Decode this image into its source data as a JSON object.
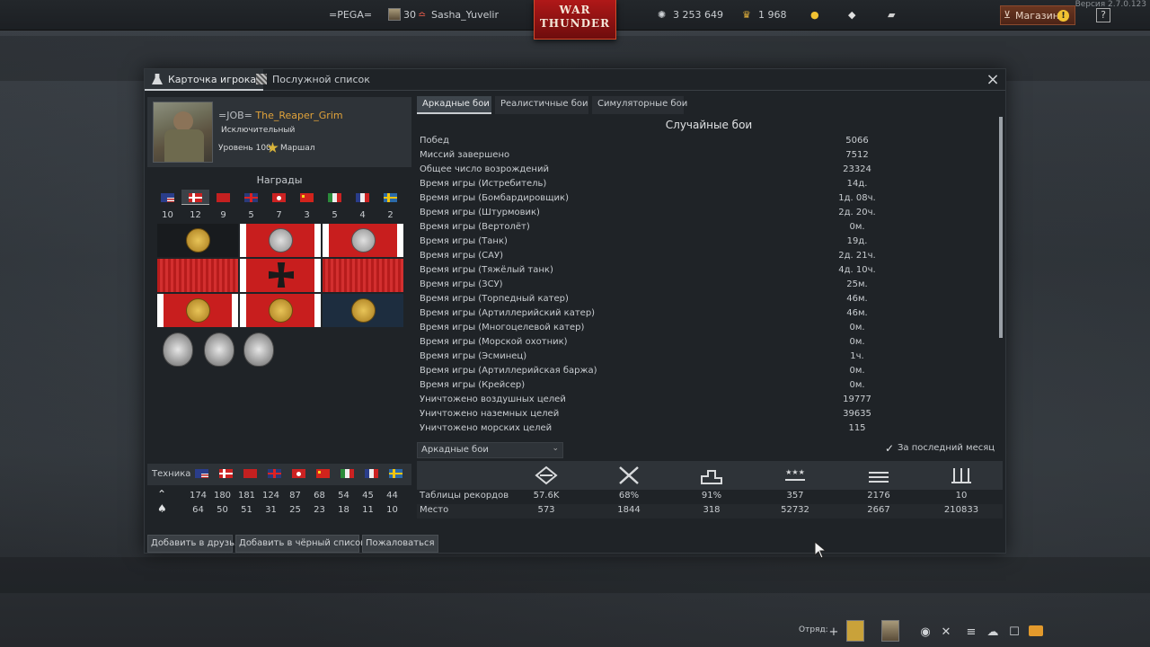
{
  "version": "Версия 2.7.0.123",
  "topbar": {
    "squadron_tag": "=PEGA=",
    "player_level": "30",
    "player_name": "Sasha_Yuvelir",
    "logo_line1": "WAR",
    "logo_line2": "THUNDER",
    "silver_lions": "3 253 649",
    "golden_eagles": "1 968",
    "shop_label": "Магазин",
    "help_label": "?"
  },
  "modal": {
    "tabs": [
      "Карточка игрока",
      "Послужной список"
    ],
    "close_label": "×"
  },
  "profile": {
    "clan_tag": "=JOB=",
    "nickname": "The_Reaper_Grim",
    "title": "Исключительный",
    "level": "Уровень 100",
    "rank": "Маршал"
  },
  "awards": {
    "title": "Награды",
    "flags": [
      "us",
      "no",
      "ussr",
      "gb",
      "jp",
      "cn",
      "it",
      "fr",
      "se"
    ],
    "counts": [
      "10",
      "12",
      "9",
      "5",
      "7",
      "3",
      "5",
      "4",
      "2"
    ]
  },
  "tech": {
    "label": "Техника",
    "flags": [
      "us",
      "no",
      "ussr",
      "gb",
      "jp",
      "cn",
      "it",
      "fr",
      "se"
    ],
    "row1_icon": "chevron-up-icon",
    "row1": [
      "174",
      "180",
      "181",
      "124",
      "87",
      "68",
      "54",
      "45",
      "44"
    ],
    "row2_icon": "spade-icon",
    "row2": [
      "64",
      "50",
      "51",
      "31",
      "25",
      "23",
      "18",
      "11",
      "10"
    ]
  },
  "buttons": {
    "add_friend": "Добавить в друзья",
    "add_blacklist": "Добавить в чёрный список",
    "complain": "Пожаловаться"
  },
  "mode_tabs": [
    "Аркадные бои",
    "Реалистичные бои",
    "Симуляторные бои"
  ],
  "stats": {
    "title": "Случайные бои",
    "rows": [
      {
        "label": "Побед",
        "value": "5066"
      },
      {
        "label": "Миссий завершено",
        "value": "7512"
      },
      {
        "label": "Общее число возрождений",
        "value": "23324"
      },
      {
        "label": "Время игры (Истребитель)",
        "value": "14д."
      },
      {
        "label": "Время игры (Бомбардировщик)",
        "value": "1д. 08ч."
      },
      {
        "label": "Время игры (Штурмовик)",
        "value": "2д. 20ч."
      },
      {
        "label": "Время игры (Вертолёт)",
        "value": "0м."
      },
      {
        "label": "Время игры (Танк)",
        "value": "19д."
      },
      {
        "label": "Время игры (САУ)",
        "value": "2д. 21ч."
      },
      {
        "label": "Время игры (Тяжёлый танк)",
        "value": "4д. 10ч."
      },
      {
        "label": "Время игры (ЗСУ)",
        "value": "25м."
      },
      {
        "label": "Время игры (Торпедный катер)",
        "value": "46м."
      },
      {
        "label": "Время игры (Артиллерийский катер)",
        "value": "46м."
      },
      {
        "label": "Время игры (Многоцелевой катер)",
        "value": "0м."
      },
      {
        "label": "Время игры (Морской охотник)",
        "value": "0м."
      },
      {
        "label": "Время игры (Эсминец)",
        "value": "1ч."
      },
      {
        "label": "Время игры (Артиллерийская баржа)",
        "value": "0м."
      },
      {
        "label": "Время игры (Крейсер)",
        "value": "0м."
      },
      {
        "label": "Уничтожено воздушных целей",
        "value": "19777"
      },
      {
        "label": "Уничтожено наземных целей",
        "value": "39635"
      },
      {
        "label": "Уничтожено морских целей",
        "value": "115"
      }
    ]
  },
  "filter": {
    "dropdown_value": "Аркадные бои",
    "last_month_label": "За последний месяц"
  },
  "records": {
    "icons": [
      "wings-icon",
      "crossed-swords-icon",
      "podium-icon",
      "three-stars-icon",
      "rank-bars-icon",
      "ladder-icon"
    ],
    "rows": [
      {
        "label": "Таблицы рекордов",
        "values": [
          "57.6K",
          "68%",
          "91%",
          "357",
          "2176",
          "10"
        ]
      },
      {
        "label": "Место",
        "values": [
          "573",
          "1844",
          "318",
          "52732",
          "2667",
          "210833"
        ]
      }
    ]
  },
  "bottom": {
    "squad_label": "Отряд:"
  }
}
